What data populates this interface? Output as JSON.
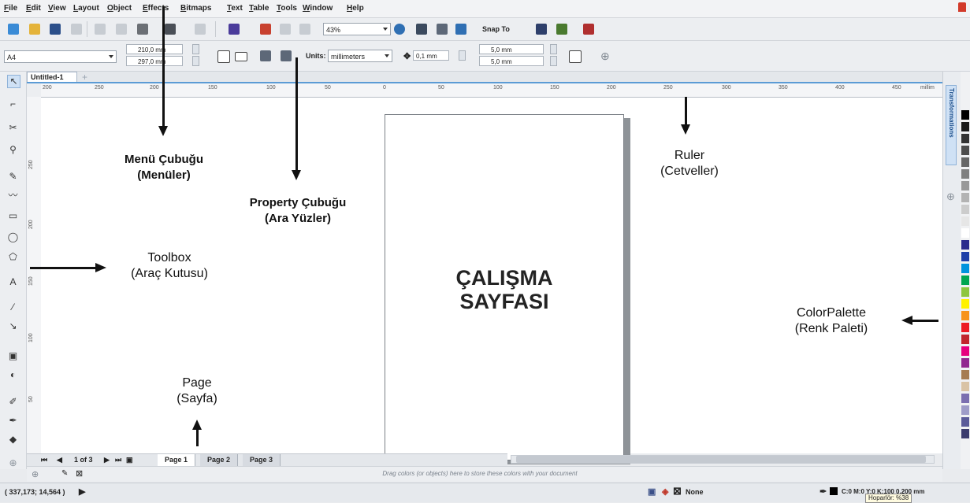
{
  "menu": [
    "File",
    "Edit",
    "View",
    "Layout",
    "Object",
    "Effects",
    "Bitmaps",
    "Text",
    "Table",
    "Tools",
    "Window",
    "Help"
  ],
  "toolbar": {
    "zoom": "43%",
    "snap_to": "Snap To"
  },
  "property_bar": {
    "paper_size": "A4",
    "width": "210,0 mm",
    "height": "297,0 mm",
    "units_label": "Units:",
    "units": "millimeters",
    "nudge": "0,1 mm",
    "dup_x": "5,0 mm",
    "dup_y": "5,0 mm"
  },
  "document": {
    "tab": "Untitled-1"
  },
  "ruler": {
    "h_labels": [
      "200",
      "250",
      "200",
      "150",
      "100",
      "50",
      "0",
      "50",
      "100",
      "150",
      "200",
      "250",
      "300",
      "350",
      "400",
      "450"
    ],
    "h_unit": "millim",
    "v_labels": [
      "250",
      "200",
      "150",
      "100",
      "50",
      "0"
    ]
  },
  "page_label": "ÇALIŞMA\nSAYFASI",
  "annotations": {
    "menu": "Menü Çubuğu\n(Menüler)",
    "property": "Property Çubuğu\n(Ara Yüzler)",
    "ruler": "Ruler\n(Cetveller)",
    "toolbox": "Toolbox\n(Araç Kutusu)",
    "palette": "ColorPalette\n(Renk Paleti)",
    "page": "Page\n(Sayfa)"
  },
  "page_nav": {
    "counter": "1 of 3",
    "pages": [
      "Page 1",
      "Page 2",
      "Page 3"
    ]
  },
  "doc_palette_message": "Drag colors (or objects) here to store these colors with your document",
  "docker": {
    "title": "Transformations"
  },
  "palette_colors": [
    "#000000",
    "#1a1a1a",
    "#333333",
    "#4d4d4d",
    "#666666",
    "#808080",
    "#999999",
    "#b3b3b3",
    "#cccccc",
    "#e6e6e6",
    "#ffffff",
    "#2b2b8c",
    "#1e3fa8",
    "#0093dd",
    "#00a651",
    "#8dc63f",
    "#fff200",
    "#f7941d",
    "#ed1c24",
    "#c1272d",
    "#e6007e",
    "#92278f",
    "#a67c52",
    "#d9c3a5",
    "#7b6fb0",
    "#9e9cc8",
    "#5a5a99",
    "#3c3c6e"
  ],
  "status": {
    "coords": "( 337,173; 14,564 )",
    "fill_none": "None",
    "outline_info": "C:0 M:0 Y:0 K:100  0,200 mm",
    "tooltip": "Hoparlör: %38"
  }
}
